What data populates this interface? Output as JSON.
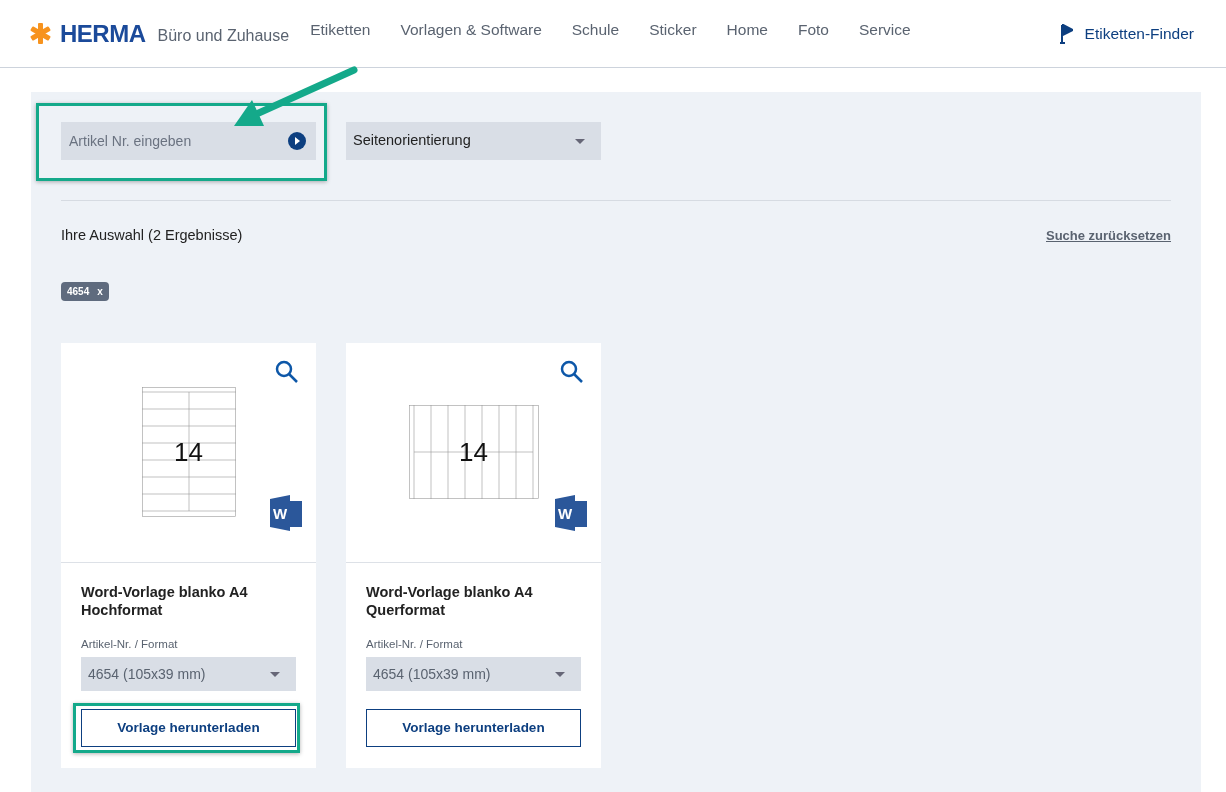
{
  "header": {
    "logo": "HERMA",
    "tagline": "Büro und Zuhause",
    "nav": [
      {
        "label": "Etiketten"
      },
      {
        "label": "Vorlagen & Software"
      },
      {
        "label": "Schule"
      },
      {
        "label": "Sticker"
      },
      {
        "label": "Home"
      },
      {
        "label": "Foto"
      },
      {
        "label": "Service"
      }
    ],
    "finder": "Etiketten-Finder"
  },
  "filters": {
    "search": {
      "placeholder": "Artikel Nr. eingeben",
      "highlighted": true
    },
    "orientation_select": {
      "value": "Seitenorientierung"
    }
  },
  "annotation_arrow": true,
  "results": {
    "heading": "Ihre Auswahl (2 Ergebnisse)",
    "reset_link": "Suche zurücksetzen",
    "chips": [
      {
        "label": "4654",
        "remove": "x"
      }
    ]
  },
  "cards": [
    {
      "kind": "portrait",
      "label_count": "14",
      "app_icon": "W",
      "title": "Word-Vorlage blanko A4 Hochformat",
      "format_label": "Artikel-Nr. / Format",
      "format_value": "4654 (105x39 mm)",
      "button": "Vorlage herunterladen",
      "highlighted": true
    },
    {
      "kind": "landscape",
      "label_count": "14",
      "app_icon": "W",
      "title": "Word-Vorlage blanko A4 Querformat",
      "format_label": "Artikel-Nr. / Format",
      "format_value": "4654 (105x39 mm)",
      "button": "Vorlage herunterladen",
      "highlighted": false
    }
  ]
}
